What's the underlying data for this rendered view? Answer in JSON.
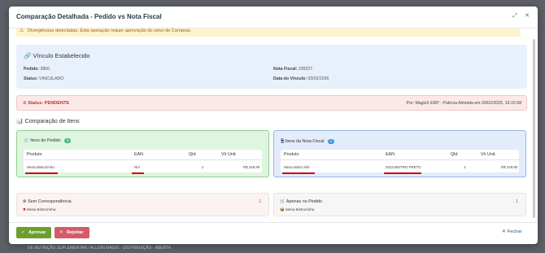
{
  "background": {
    "row_text": "DE NUTRIÇÃO SUPLEMENTAR / ALUSÍN MAGIS · DISTRIBUIÇÃO · ABERTA"
  },
  "modal": {
    "title": "Comparação Detalhada - Pedido vs Nota Fiscal",
    "expand_icon": "expand-icon",
    "close_icon": "close-icon"
  },
  "alert": {
    "icon": "warning-icon",
    "text": "Divergências detectadas. Esta operação requer aprovação do setor de Compras."
  },
  "vinculo": {
    "icon": "link-icon",
    "title": "Vínculo Estabelecido",
    "pedido_label": "Pedido:",
    "pedido_value": "3860",
    "status_label": "Status:",
    "status_value": "VINCULADO",
    "nota_label": "Nota Fiscal:",
    "nota_value": "239227",
    "data_label": "Data do Vínculo:",
    "data_value": "03/02/2026"
  },
  "status": {
    "icon": "clock-icon",
    "label": "Status: PENDENTE",
    "by": "Por: MagisS ERP - Patrícia Almeida em 03/02/2026, 15:15:58"
  },
  "comparison": {
    "icon": "chart-icon",
    "title": "Comparação de Itens",
    "pedido": {
      "icon": "cart-icon",
      "title": "Itens do Pedido",
      "count": "0",
      "badge_color": "#48bb78",
      "headers": [
        "Produto",
        "EAN",
        "Qtd",
        "Vlr Unit."
      ],
      "rows": [
        {
          "produto": "Mesa Bistrozinha",
          "ean": "N/A",
          "qtd": "2",
          "vlr": "R$ 249,90"
        }
      ]
    },
    "nota": {
      "icon": "document-icon",
      "title": "Itens da Nota Fiscal",
      "count": "1",
      "badge_color": "#4299e1",
      "headers": [
        "Produto",
        "EAN",
        "Qtd",
        "Vlr Unit."
      ],
      "rows": [
        {
          "produto": "Mesa Bistro Kiki",
          "ean": "2023 BISTRO PRETO",
          "qtd": "1",
          "vlr": "R$ 249,90"
        }
      ]
    }
  },
  "cards": {
    "sem": {
      "icon": "circle-x-icon",
      "title": "Sem Correspondência",
      "count": "1",
      "item_icon": "x-icon",
      "item": "Mesa Bistrozinha"
    },
    "apenas": {
      "icon": "cart-icon",
      "title": "Apenas no Pedido",
      "count": "1",
      "item_icon": "box-icon",
      "item": "Mesa Bistrozinha"
    }
  },
  "footer": {
    "approve": "Aprovar",
    "reject": "Rejeitar",
    "close": "Fechar"
  }
}
